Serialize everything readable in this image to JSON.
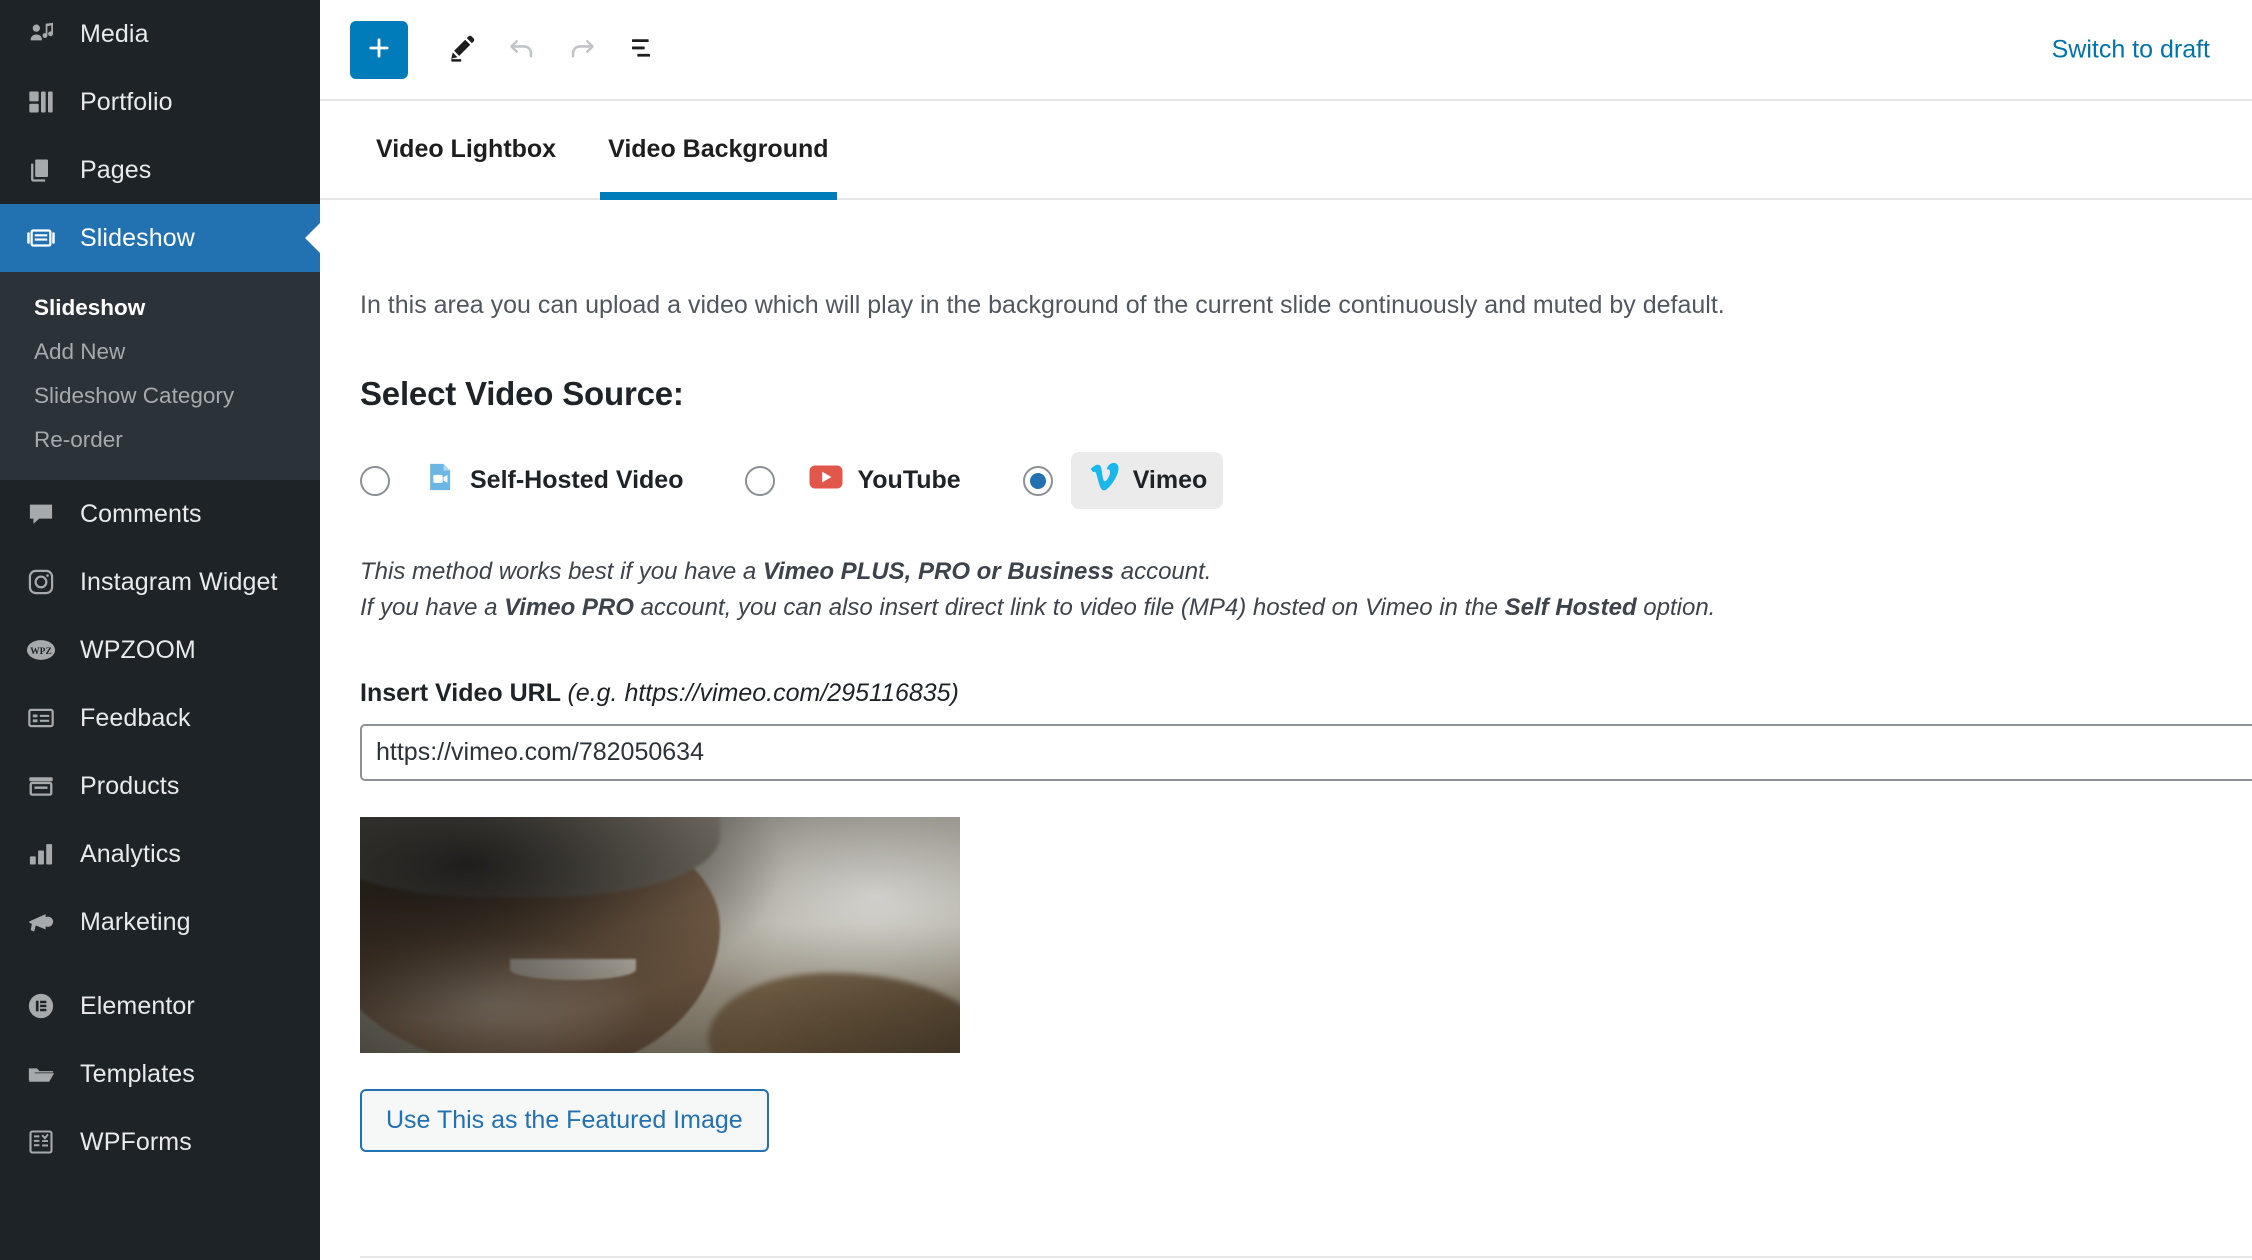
{
  "sidebar": {
    "items": [
      {
        "label": "Media",
        "icon": "media-icon",
        "current": false
      },
      {
        "label": "Portfolio",
        "icon": "portfolio-icon",
        "current": false
      },
      {
        "label": "Pages",
        "icon": "pages-icon",
        "current": false
      },
      {
        "label": "Slideshow",
        "icon": "slideshow-icon",
        "current": true
      }
    ],
    "submenu": [
      {
        "label": "Slideshow",
        "current": true
      },
      {
        "label": "Add New",
        "current": false
      },
      {
        "label": "Slideshow Category",
        "current": false
      },
      {
        "label": "Re-order",
        "current": false
      }
    ],
    "items_after": [
      {
        "label": "Comments",
        "icon": "comment-bubble-icon"
      },
      {
        "label": "Instagram Widget",
        "icon": "instagram-icon"
      },
      {
        "label": "WPZOOM",
        "icon": "wpzoom-icon"
      },
      {
        "label": "Feedback",
        "icon": "feedback-icon"
      },
      {
        "label": "Products",
        "icon": "products-icon"
      },
      {
        "label": "Analytics",
        "icon": "analytics-bars-icon"
      },
      {
        "label": "Marketing",
        "icon": "megaphone-icon"
      }
    ],
    "items_plugins": [
      {
        "label": "Elementor",
        "icon": "elementor-icon"
      },
      {
        "label": "Templates",
        "icon": "folder-icon"
      },
      {
        "label": "WPForms",
        "icon": "wpforms-icon"
      }
    ],
    "active_color": "#2271b1",
    "background": "#1d2327"
  },
  "toolbar": {
    "add_block_label": "+",
    "add_block_icon": "plus-icon",
    "edit_icon": "pencil-icon",
    "undo_icon": "undo-arrow-icon",
    "redo_icon": "redo-arrow-icon",
    "list_view_icon": "document-outline-icon",
    "switch_to_draft": "Switch to draft",
    "link_color": "#0073aa"
  },
  "tabs": [
    {
      "label": "Video Lightbox",
      "active": false
    },
    {
      "label": "Video Background",
      "active": true
    }
  ],
  "panel": {
    "intro": "In this area you can upload a video which will play in the background of the current slide continuously and muted by default.",
    "section_title": "Select Video Source:",
    "sources": [
      {
        "label": "Self-Hosted Video",
        "icon": "video-file-icon",
        "selected": false
      },
      {
        "label": "YouTube",
        "icon": "youtube-icon",
        "selected": false
      },
      {
        "label": "Vimeo",
        "icon": "vimeo-icon",
        "selected": true
      }
    ],
    "hint_line1_a": "This method works best if you have a ",
    "hint_line1_b": "Vimeo PLUS, PRO or Business",
    "hint_line1_c": " account.",
    "hint_line2_a": "If you have a ",
    "hint_line2_b": "Vimeo PRO",
    "hint_line2_c": " account, you can also insert direct link to video file (MP4) hosted on Vimeo in the ",
    "hint_line2_d": "Self Hosted",
    "hint_line2_e": " option.",
    "url_label": "Insert Video URL",
    "url_example": "(e.g. https://vimeo.com/295116835)",
    "url_value": "https://vimeo.com/782050634",
    "url_placeholder": "https://vimeo.com/",
    "thumbnail_alt": "video-thumbnail-smiling-woman-in-beanie",
    "featured_button": "Use This as the Featured Image"
  }
}
